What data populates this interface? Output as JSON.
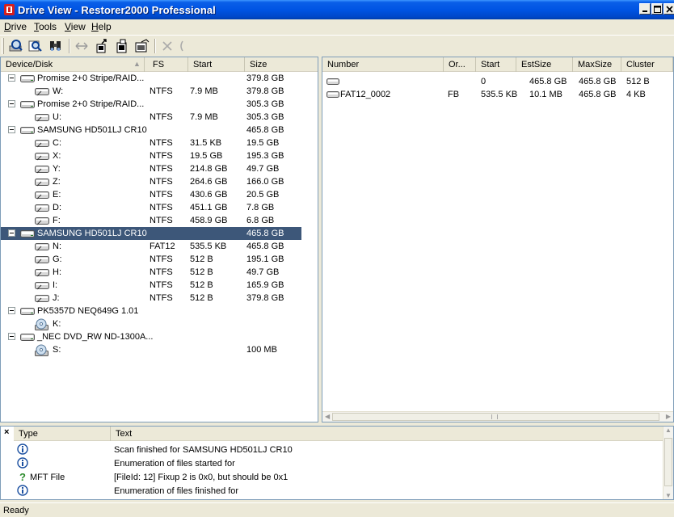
{
  "window": {
    "title": "Drive View - Restorer2000 Professional"
  },
  "menu": [
    "Drive",
    "Tools",
    "View",
    "Help"
  ],
  "left": {
    "columns": [
      "Device/Disk",
      "FS",
      "Start",
      "Size"
    ],
    "rows": [
      {
        "label": "Promise 2+0 Stripe/RAID...",
        "fs": "",
        "start": "",
        "size": "379.8 GB",
        "level": 0,
        "icon": "hdd-icon"
      },
      {
        "label": "W:",
        "fs": "NTFS",
        "start": "7.9 MB",
        "size": "379.8 GB",
        "level": 1,
        "icon": "partition-icon"
      },
      {
        "label": "Promise 2+0 Stripe/RAID...",
        "fs": "",
        "start": "",
        "size": "305.3 GB",
        "level": 0,
        "icon": "hdd-icon"
      },
      {
        "label": "U:",
        "fs": "NTFS",
        "start": "7.9 MB",
        "size": "305.3 GB",
        "level": 1,
        "icon": "partition-icon"
      },
      {
        "label": "SAMSUNG HD501LJ CR10",
        "fs": "",
        "start": "",
        "size": "465.8 GB",
        "level": 0,
        "icon": "hdd-icon"
      },
      {
        "label": "C:",
        "fs": "NTFS",
        "start": "31.5 KB",
        "size": "19.5 GB",
        "level": 1,
        "icon": "partition-icon"
      },
      {
        "label": "X:",
        "fs": "NTFS",
        "start": "19.5 GB",
        "size": "195.3 GB",
        "level": 1,
        "icon": "partition-icon"
      },
      {
        "label": "Y:",
        "fs": "NTFS",
        "start": "214.8 GB",
        "size": "49.7 GB",
        "level": 1,
        "icon": "partition-icon"
      },
      {
        "label": "Z:",
        "fs": "NTFS",
        "start": "264.6 GB",
        "size": "166.0 GB",
        "level": 1,
        "icon": "partition-icon"
      },
      {
        "label": "E:",
        "fs": "NTFS",
        "start": "430.6 GB",
        "size": "20.5 GB",
        "level": 1,
        "icon": "partition-icon"
      },
      {
        "label": "D:",
        "fs": "NTFS",
        "start": "451.1 GB",
        "size": "7.8 GB",
        "level": 1,
        "icon": "partition-icon"
      },
      {
        "label": "F:",
        "fs": "NTFS",
        "start": "458.9 GB",
        "size": "6.8 GB",
        "level": 1,
        "icon": "partition-icon"
      },
      {
        "label": "SAMSUNG HD501LJ CR10",
        "fs": "",
        "start": "",
        "size": "465.8 GB",
        "level": 0,
        "icon": "hdd-icon",
        "selected": true
      },
      {
        "label": "N:",
        "fs": "FAT12",
        "start": "535.5 KB",
        "size": "465.8 GB",
        "level": 1,
        "icon": "partition-icon"
      },
      {
        "label": "G:",
        "fs": "NTFS",
        "start": "512 B",
        "size": "195.1 GB",
        "level": 1,
        "icon": "partition-icon"
      },
      {
        "label": "H:",
        "fs": "NTFS",
        "start": "512 B",
        "size": "49.7 GB",
        "level": 1,
        "icon": "partition-icon"
      },
      {
        "label": "I:",
        "fs": "NTFS",
        "start": "512 B",
        "size": "165.9 GB",
        "level": 1,
        "icon": "partition-icon"
      },
      {
        "label": "J:",
        "fs": "NTFS",
        "start": "512 B",
        "size": "379.8 GB",
        "level": 1,
        "icon": "partition-icon"
      },
      {
        "label": "PK5357D NEQ649G 1.01",
        "fs": "",
        "start": "",
        "size": "",
        "level": 0,
        "icon": "hdd-icon"
      },
      {
        "label": "K:",
        "fs": "",
        "start": "",
        "size": "",
        "level": 1,
        "icon": "cd-icon"
      },
      {
        "label": "_NEC DVD_RW ND-1300A...",
        "fs": "",
        "start": "",
        "size": "",
        "level": 0,
        "icon": "hdd-icon"
      },
      {
        "label": "S:",
        "fs": "",
        "start": "",
        "size": "100 MB",
        "level": 1,
        "icon": "cd-icon"
      }
    ]
  },
  "right": {
    "columns": [
      "Number",
      "Or...",
      "Start",
      "EstSize",
      "MaxSize",
      "Cluster"
    ],
    "rows": [
      {
        "number": "",
        "or": "",
        "start": "0",
        "est": "465.8 GB",
        "max": "465.8 GB",
        "cluster": "512 B"
      },
      {
        "number": "FAT12_0002",
        "or": "FB",
        "start": "535.5 KB",
        "est": "10.1 MB",
        "max": "465.8 GB",
        "cluster": "4 KB"
      }
    ]
  },
  "log": {
    "columns": [
      "Type",
      "Text"
    ],
    "rows": [
      {
        "icon": "info-icon",
        "type": "",
        "text": "Scan finished for SAMSUNG HD501LJ CR10"
      },
      {
        "icon": "info-icon",
        "type": "",
        "text": "Enumeration of files started for"
      },
      {
        "icon": "question-icon",
        "type": "MFT File",
        "text": "[FileId: 12] Fixup 2 is 0x0, but should be 0x1"
      },
      {
        "icon": "info-icon",
        "type": "",
        "text": "Enumeration of files finished for"
      }
    ]
  },
  "status": {
    "text": "Ready"
  }
}
